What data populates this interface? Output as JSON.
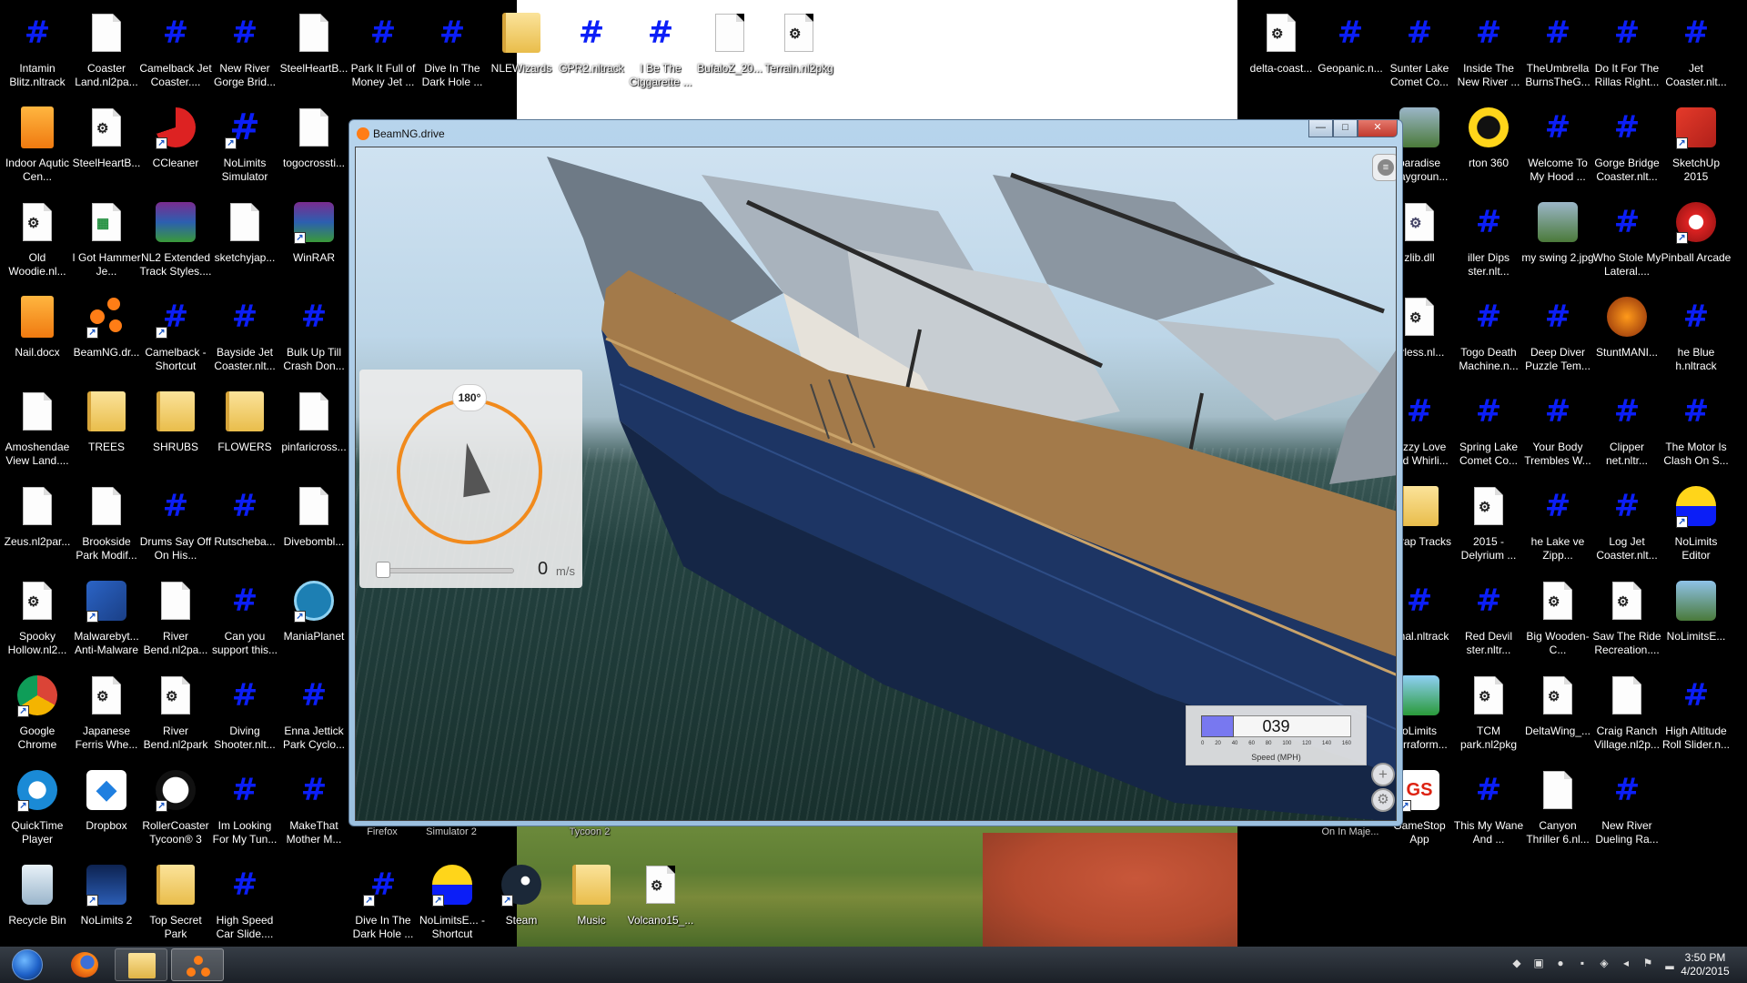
{
  "colors": {
    "accent_orange": "#f18a1c",
    "speed_fill": "#7878f0",
    "nl_hash_blue": "#0b1ef7"
  },
  "desktop_icons": [
    {
      "name": "Intamin Blitz.nltrack",
      "type": "hash"
    },
    {
      "name": "Coaster Land.nl2pa...",
      "type": "doc"
    },
    {
      "name": "Camelback Jet Coaster....",
      "type": "hash"
    },
    {
      "name": "New River Gorge Brid...",
      "type": "hash"
    },
    {
      "name": "SteelHeartB...",
      "type": "doc"
    },
    {
      "name": "Park It Full of Money Jet ...",
      "type": "hash"
    },
    {
      "name": "Dive In The Dark Hole ...",
      "type": "hash"
    },
    {
      "name": "NLEWizards",
      "type": "folder"
    },
    {
      "name": "GPR2.nltrack",
      "type": "hash"
    },
    {
      "name": "I Be The Ciggarette ...",
      "type": "hash"
    },
    {
      "name": "BufaloZ_20...",
      "type": "doc"
    },
    {
      "name": "Terrain.nl2pkg",
      "type": "nlpkg"
    },
    {
      "name": "Indoor Aqutic Cen...",
      "type": "orange"
    },
    {
      "name": "SteelHeartB...",
      "type": "nlpkg"
    },
    {
      "name": "CCleaner",
      "type": "ccleaner",
      "shortcut": true
    },
    {
      "name": "NoLimits Simulator",
      "type": "nlsim",
      "shortcut": true
    },
    {
      "name": "togocrossti...",
      "type": "doc"
    },
    {
      "name": "Old Woodie.nl...",
      "type": "nlpkg"
    },
    {
      "name": "I Got Hammer Je...",
      "type": "xls"
    },
    {
      "name": "NL2 Extended Track Styles....",
      "type": "rar"
    },
    {
      "name": "sketchyjap...",
      "type": "doc"
    },
    {
      "name": "WinRAR",
      "type": "rar",
      "shortcut": true
    },
    {
      "name": "Nail.docx",
      "type": "orange"
    },
    {
      "name": "BeamNG.dr...",
      "type": "beamng",
      "shortcut": true
    },
    {
      "name": "Camelback - Shortcut",
      "type": "hash",
      "shortcut": true
    },
    {
      "name": "Bayside Jet Coaster.nlt...",
      "type": "hash"
    },
    {
      "name": "Bulk Up Till Crash Don...",
      "type": "hash"
    },
    {
      "name": "Amoshendae View Land....",
      "type": "doc"
    },
    {
      "name": "TREES",
      "type": "folder"
    },
    {
      "name": "SHRUBS",
      "type": "folder"
    },
    {
      "name": "FLOWERS",
      "type": "folder"
    },
    {
      "name": "pinfaricross...",
      "type": "doc"
    },
    {
      "name": "Zeus.nl2par...",
      "type": "doc"
    },
    {
      "name": "Brookside Park Modif...",
      "type": "doc"
    },
    {
      "name": "Drums Say Off On His...",
      "type": "hash"
    },
    {
      "name": "Rutscheba...",
      "type": "hash"
    },
    {
      "name": "Divebombl...",
      "type": "doc"
    },
    {
      "name": "Spooky Hollow.nl2...",
      "type": "nlpkg"
    },
    {
      "name": "Malwarebyt... Anti-Malware",
      "type": "mbam",
      "shortcut": true
    },
    {
      "name": "River Bend.nl2pa...",
      "type": "doc"
    },
    {
      "name": "Can you support this...",
      "type": "hash"
    },
    {
      "name": "ManiaPlanet",
      "type": "mania",
      "shortcut": true
    },
    {
      "name": "Google Chrome",
      "type": "chrome",
      "shortcut": true
    },
    {
      "name": "Japanese Ferris Whe...",
      "type": "nlpkg"
    },
    {
      "name": "River Bend.nl2park",
      "type": "nlpkg"
    },
    {
      "name": "Diving Shooter.nlt...",
      "type": "hash"
    },
    {
      "name": "Enna Jettick Park Cyclo...",
      "type": "hash"
    },
    {
      "name": "QuickTime Player",
      "type": "quicktime",
      "shortcut": true
    },
    {
      "name": "Dropbox",
      "type": "dropbox"
    },
    {
      "name": "RollerCoaster Tycoon® 3",
      "type": "panda",
      "shortcut": true
    },
    {
      "name": "Im Looking For My Tun...",
      "type": "hash"
    },
    {
      "name": "MakeThat Mother M...",
      "type": "hash"
    },
    {
      "name": "Recycle Bin",
      "type": "recycle"
    },
    {
      "name": "NoLimits 2",
      "type": "nl2",
      "shortcut": true
    },
    {
      "name": "Top Secret Park",
      "type": "folder"
    },
    {
      "name": "High Speed Car Slide....",
      "type": "hash"
    },
    {
      "name": "Dive In The Dark Hole ...",
      "type": "hash",
      "shortcut": true
    },
    {
      "name": "NoLimitsE... - Shortcut",
      "type": "nleditor",
      "shortcut": true
    },
    {
      "name": "Steam",
      "type": "steam",
      "shortcut": true
    },
    {
      "name": "Music",
      "type": "folder"
    },
    {
      "name": "Volcano15_...",
      "type": "nlpkg"
    },
    {
      "name": "delta-coast...",
      "type": "nlpkg"
    },
    {
      "name": "Geopanic.n...",
      "type": "hash"
    },
    {
      "name": "Sunter Lake Comet Co...",
      "type": "hash"
    },
    {
      "name": "Inside The New River ...",
      "type": "hash"
    },
    {
      "name": "TheUmbrella BurnsTheG...",
      "type": "hash"
    },
    {
      "name": "Do It For The Rillas Right...",
      "type": "hash"
    },
    {
      "name": "Jet Coaster.nlt...",
      "type": "hash"
    },
    {
      "name": "paradise playgroun...",
      "type": "photo"
    },
    {
      "name": "rton 360",
      "type": "yellowring"
    },
    {
      "name": "Welcome To My Hood ...",
      "type": "hash"
    },
    {
      "name": "Gorge Bridge Coaster.nlt...",
      "type": "hash"
    },
    {
      "name": "SketchUp 2015",
      "type": "sketchup",
      "shortcut": true
    },
    {
      "name": "zlib.dll",
      "type": "dll"
    },
    {
      "name": "iller Dips ster.nlt...",
      "type": "hash"
    },
    {
      "name": "my swing 2.jpg",
      "type": "photo"
    },
    {
      "name": "Who Stole My Lateral....",
      "type": "hash"
    },
    {
      "name": "Pinball Arcade",
      "type": "pinball",
      "shortcut": true
    },
    {
      "name": "orless.nl...",
      "type": "nlpkg"
    },
    {
      "name": "Togo Death Machine.n...",
      "type": "hash"
    },
    {
      "name": "Deep Diver Puzzle Tem...",
      "type": "hash"
    },
    {
      "name": "StuntMANI...",
      "type": "stunt"
    },
    {
      "name": "he Blue h.nltrack",
      "type": "hash"
    },
    {
      "name": "Dizzy Love and Whirli...",
      "type": "hash"
    },
    {
      "name": "Spring Lake Comet Co...",
      "type": "hash"
    },
    {
      "name": "Your Body Trembles W...",
      "type": "hash"
    },
    {
      "name": "Clipper net.nltr...",
      "type": "hash"
    },
    {
      "name": "The Motor Is Clash On S...",
      "type": "hash"
    },
    {
      "name": "Scrap Tracks",
      "type": "folder"
    },
    {
      "name": "2015 - Delyrium ...",
      "type": "nlpkg"
    },
    {
      "name": "he Lake ve Zipp...",
      "type": "hash"
    },
    {
      "name": "Log Jet Coaster.nlt...",
      "type": "hash"
    },
    {
      "name": "NoLimits Editor",
      "type": "nleditor",
      "shortcut": true
    },
    {
      "name": "Final.nltrack",
      "type": "hash"
    },
    {
      "name": "Red Devil ster.nltr...",
      "type": "hash"
    },
    {
      "name": "Big Wooden-C...",
      "type": "nlpkg"
    },
    {
      "name": "Saw The Ride Recreation....",
      "type": "nlpkg"
    },
    {
      "name": "NoLimitsE...",
      "type": "loop"
    },
    {
      "name": "oLimits Terraform...",
      "type": "terraform"
    },
    {
      "name": "TCM park.nl2pkg",
      "type": "nlpkg"
    },
    {
      "name": "DeltaWing_...",
      "type": "nlpkg"
    },
    {
      "name": "Craig Ranch Village.nl2p...",
      "type": "doc"
    },
    {
      "name": "High Altitude Roll Slider.n...",
      "type": "hash"
    },
    {
      "name": "GameStop App",
      "type": "gamestop",
      "shortcut": true
    },
    {
      "name": "This My Wane And ...",
      "type": "hash"
    },
    {
      "name": "Canyon Thriller 6.nl...",
      "type": "doc"
    },
    {
      "name": "New River Dueling Ra...",
      "type": "hash"
    }
  ],
  "behind_window_labels": [
    "Firefox",
    "Simulator 2",
    "Tycoon 2",
    "On In Maje..."
  ],
  "window": {
    "title": "BeamNG.drive",
    "min_glyph": "—",
    "max_glyph": "□",
    "close_glyph": "✕"
  },
  "hud": {
    "compass_heading": "180°",
    "speed_ms": "0",
    "speed_ms_unit": "m/s",
    "speed_mph": "039",
    "speed_fraction": 0.22,
    "speed_ticks": [
      "0",
      "20",
      "40",
      "60",
      "80",
      "100",
      "120",
      "140",
      "160"
    ],
    "speed_label": "Speed (MPH)",
    "zoom_glyph": "+",
    "settings_glyph": "⚙",
    "menu_glyph": "≡"
  },
  "taskbar": {
    "time": "3:50 PM",
    "date": "4/20/2015"
  }
}
